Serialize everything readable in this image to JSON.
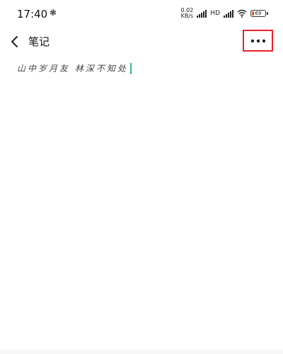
{
  "status_bar": {
    "time": "17:40",
    "notification_glyph": "❃",
    "net_speed_value": "0.02",
    "net_speed_unit": "KB/s",
    "network_type": "HD",
    "battery_level": "69"
  },
  "header": {
    "title": "笔记",
    "back_icon": "chevron-left-icon",
    "more_icon": "more-horizontal-icon"
  },
  "note": {
    "content": "山中岁月友 林深不知处"
  },
  "colors": {
    "highlight_border": "#e8202a",
    "cursor": "#39b38a"
  }
}
